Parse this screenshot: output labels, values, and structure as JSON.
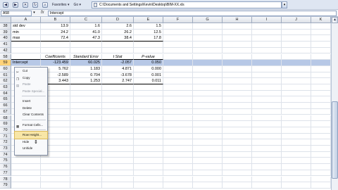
{
  "toolbar": {
    "favorites_label": "Favorites",
    "go_label": "Go",
    "address": "C:\\Documents and Settings\\Kevin\\Desktop\\BIM-XX.xls"
  },
  "formula_bar": {
    "name_box": "A58",
    "formula": "Intercept"
  },
  "columns": [
    "A",
    "B",
    "C",
    "D",
    "E",
    "F",
    "G",
    "H",
    "I",
    "J",
    "K"
  ],
  "rows": [
    {
      "num": "38",
      "cells": [
        "std dev",
        "13.9",
        "1.6",
        "2.6",
        "1.5"
      ]
    },
    {
      "num": "39",
      "cells": [
        "min",
        "24.2",
        "41.0",
        "26.2",
        "12.5"
      ]
    },
    {
      "num": "40",
      "cells": [
        "max",
        "72.4",
        "47.3",
        "38.4",
        "17.8"
      ]
    },
    {
      "num": "41",
      "cells": [
        "",
        "",
        "",
        "",
        ""
      ]
    },
    {
      "num": "42",
      "cells": [
        "",
        "",
        "",
        "",
        ""
      ]
    },
    {
      "num": "58",
      "cells": [
        "",
        "Coefficients",
        "Standard Error",
        "t Stat",
        "P-value"
      ]
    },
    {
      "num": "59",
      "cells": [
        "Intercept",
        "-123.459",
        "60.025",
        "-2.057",
        "0.050"
      ]
    },
    {
      "num": "60",
      "cells": [
        "",
        "5.762",
        "1.183",
        "4.871",
        "0.000"
      ]
    },
    {
      "num": "61",
      "cells": [
        "",
        "-2.589",
        "0.704",
        "-3.678",
        "0.001"
      ]
    },
    {
      "num": "62",
      "cells": [
        "",
        "3.443",
        "1.253",
        "2.747",
        "0.011"
      ]
    },
    {
      "num": "63",
      "cells": [
        "",
        "",
        "",
        "",
        ""
      ]
    },
    {
      "num": "64",
      "cells": [
        "",
        "",
        "",
        "",
        ""
      ]
    },
    {
      "num": "65",
      "cells": [
        "",
        "",
        "",
        "",
        ""
      ]
    },
    {
      "num": "66",
      "cells": [
        "",
        "",
        "",
        "",
        ""
      ]
    },
    {
      "num": "67",
      "cells": [
        "",
        "",
        "",
        "",
        ""
      ]
    },
    {
      "num": "68",
      "cells": [
        "",
        "",
        "",
        "",
        ""
      ]
    },
    {
      "num": "69",
      "cells": [
        "",
        "",
        "",
        "",
        ""
      ]
    },
    {
      "num": "70",
      "cells": [
        "",
        "",
        "",
        "",
        ""
      ]
    },
    {
      "num": "71",
      "cells": [
        "",
        "",
        "",
        "",
        ""
      ]
    },
    {
      "num": "72",
      "cells": [
        "",
        "",
        "",
        "",
        ""
      ]
    },
    {
      "num": "73",
      "cells": [
        "",
        "",
        "",
        "",
        ""
      ]
    },
    {
      "num": "74",
      "cells": [
        "",
        "",
        "",
        "",
        ""
      ]
    },
    {
      "num": "75",
      "cells": [
        "",
        "",
        "",
        "",
        ""
      ]
    },
    {
      "num": "76",
      "cells": [
        "",
        "",
        "",
        "",
        ""
      ]
    },
    {
      "num": "77",
      "cells": [
        "",
        "",
        "",
        "",
        ""
      ]
    },
    {
      "num": "78",
      "cells": [
        "",
        "",
        "",
        "",
        ""
      ]
    },
    {
      "num": "79",
      "cells": [
        "",
        "",
        "",
        "",
        ""
      ]
    }
  ],
  "context_menu": {
    "items": [
      {
        "label": "Cut",
        "icon": "scissors-icon"
      },
      {
        "label": "Copy",
        "icon": "copy-icon"
      },
      {
        "label": "Paste",
        "icon": "paste-icon",
        "disabled": true
      },
      {
        "label": "Paste Special...",
        "disabled": true
      },
      {
        "label": "Insert"
      },
      {
        "label": "Delete"
      },
      {
        "label": "Clear Contents"
      },
      {
        "label": "Format Cells...",
        "icon": "format-cells-icon"
      },
      {
        "label": "Row Height...",
        "highlighted": true
      },
      {
        "label": "Hide"
      },
      {
        "label": "Unhide"
      }
    ]
  },
  "colors": {
    "selection": "#b7c8e6",
    "row_header_selected": "#ffd37a",
    "menu_highlight": "#f8e6a6"
  }
}
